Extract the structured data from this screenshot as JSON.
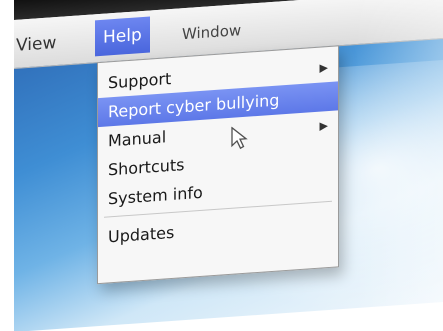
{
  "menubar": {
    "items": [
      {
        "label": "View"
      },
      {
        "label": "Help"
      },
      {
        "label": "Window"
      }
    ]
  },
  "help_menu": {
    "items": [
      {
        "label": "Support",
        "has_submenu": true
      },
      {
        "label": "Report cyber bullying",
        "highlighted": true
      },
      {
        "label": "Manual",
        "has_submenu": true
      },
      {
        "label": "Shortcuts"
      },
      {
        "label": "System info"
      },
      {
        "label": "Updates"
      }
    ]
  },
  "icons": {
    "submenu_arrow": "chevron-right-icon",
    "cursor": "mouse-pointer-icon"
  },
  "colors": {
    "menu_highlight": "#5d78e8",
    "desktop": "#3f8ed4",
    "menubar": "#e6e6e6"
  }
}
